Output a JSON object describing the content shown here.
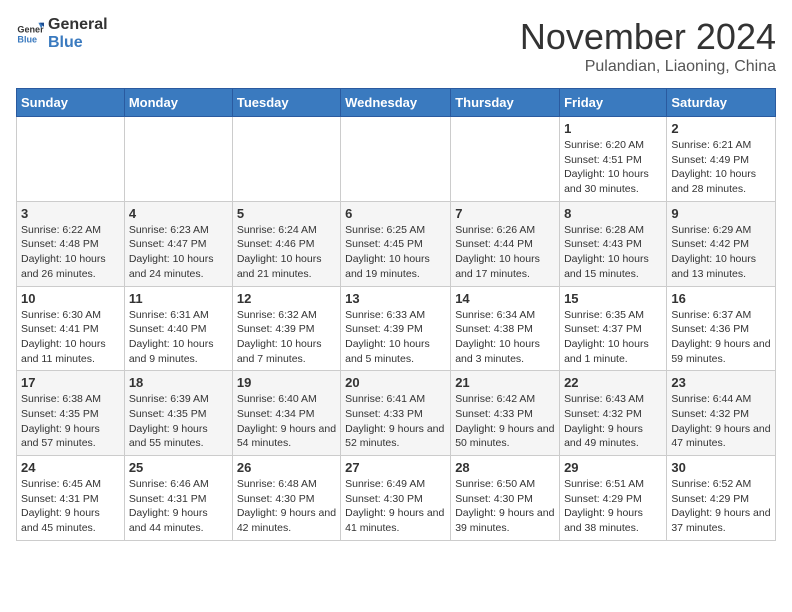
{
  "logo": {
    "general": "General",
    "blue": "Blue"
  },
  "header": {
    "month": "November 2024",
    "location": "Pulandian, Liaoning, China"
  },
  "weekdays": [
    "Sunday",
    "Monday",
    "Tuesday",
    "Wednesday",
    "Thursday",
    "Friday",
    "Saturday"
  ],
  "weeks": [
    [
      {
        "day": "",
        "info": ""
      },
      {
        "day": "",
        "info": ""
      },
      {
        "day": "",
        "info": ""
      },
      {
        "day": "",
        "info": ""
      },
      {
        "day": "",
        "info": ""
      },
      {
        "day": "1",
        "info": "Sunrise: 6:20 AM\nSunset: 4:51 PM\nDaylight: 10 hours and 30 minutes."
      },
      {
        "day": "2",
        "info": "Sunrise: 6:21 AM\nSunset: 4:49 PM\nDaylight: 10 hours and 28 minutes."
      }
    ],
    [
      {
        "day": "3",
        "info": "Sunrise: 6:22 AM\nSunset: 4:48 PM\nDaylight: 10 hours and 26 minutes."
      },
      {
        "day": "4",
        "info": "Sunrise: 6:23 AM\nSunset: 4:47 PM\nDaylight: 10 hours and 24 minutes."
      },
      {
        "day": "5",
        "info": "Sunrise: 6:24 AM\nSunset: 4:46 PM\nDaylight: 10 hours and 21 minutes."
      },
      {
        "day": "6",
        "info": "Sunrise: 6:25 AM\nSunset: 4:45 PM\nDaylight: 10 hours and 19 minutes."
      },
      {
        "day": "7",
        "info": "Sunrise: 6:26 AM\nSunset: 4:44 PM\nDaylight: 10 hours and 17 minutes."
      },
      {
        "day": "8",
        "info": "Sunrise: 6:28 AM\nSunset: 4:43 PM\nDaylight: 10 hours and 15 minutes."
      },
      {
        "day": "9",
        "info": "Sunrise: 6:29 AM\nSunset: 4:42 PM\nDaylight: 10 hours and 13 minutes."
      }
    ],
    [
      {
        "day": "10",
        "info": "Sunrise: 6:30 AM\nSunset: 4:41 PM\nDaylight: 10 hours and 11 minutes."
      },
      {
        "day": "11",
        "info": "Sunrise: 6:31 AM\nSunset: 4:40 PM\nDaylight: 10 hours and 9 minutes."
      },
      {
        "day": "12",
        "info": "Sunrise: 6:32 AM\nSunset: 4:39 PM\nDaylight: 10 hours and 7 minutes."
      },
      {
        "day": "13",
        "info": "Sunrise: 6:33 AM\nSunset: 4:39 PM\nDaylight: 10 hours and 5 minutes."
      },
      {
        "day": "14",
        "info": "Sunrise: 6:34 AM\nSunset: 4:38 PM\nDaylight: 10 hours and 3 minutes."
      },
      {
        "day": "15",
        "info": "Sunrise: 6:35 AM\nSunset: 4:37 PM\nDaylight: 10 hours and 1 minute."
      },
      {
        "day": "16",
        "info": "Sunrise: 6:37 AM\nSunset: 4:36 PM\nDaylight: 9 hours and 59 minutes."
      }
    ],
    [
      {
        "day": "17",
        "info": "Sunrise: 6:38 AM\nSunset: 4:35 PM\nDaylight: 9 hours and 57 minutes."
      },
      {
        "day": "18",
        "info": "Sunrise: 6:39 AM\nSunset: 4:35 PM\nDaylight: 9 hours and 55 minutes."
      },
      {
        "day": "19",
        "info": "Sunrise: 6:40 AM\nSunset: 4:34 PM\nDaylight: 9 hours and 54 minutes."
      },
      {
        "day": "20",
        "info": "Sunrise: 6:41 AM\nSunset: 4:33 PM\nDaylight: 9 hours and 52 minutes."
      },
      {
        "day": "21",
        "info": "Sunrise: 6:42 AM\nSunset: 4:33 PM\nDaylight: 9 hours and 50 minutes."
      },
      {
        "day": "22",
        "info": "Sunrise: 6:43 AM\nSunset: 4:32 PM\nDaylight: 9 hours and 49 minutes."
      },
      {
        "day": "23",
        "info": "Sunrise: 6:44 AM\nSunset: 4:32 PM\nDaylight: 9 hours and 47 minutes."
      }
    ],
    [
      {
        "day": "24",
        "info": "Sunrise: 6:45 AM\nSunset: 4:31 PM\nDaylight: 9 hours and 45 minutes."
      },
      {
        "day": "25",
        "info": "Sunrise: 6:46 AM\nSunset: 4:31 PM\nDaylight: 9 hours and 44 minutes."
      },
      {
        "day": "26",
        "info": "Sunrise: 6:48 AM\nSunset: 4:30 PM\nDaylight: 9 hours and 42 minutes."
      },
      {
        "day": "27",
        "info": "Sunrise: 6:49 AM\nSunset: 4:30 PM\nDaylight: 9 hours and 41 minutes."
      },
      {
        "day": "28",
        "info": "Sunrise: 6:50 AM\nSunset: 4:30 PM\nDaylight: 9 hours and 39 minutes."
      },
      {
        "day": "29",
        "info": "Sunrise: 6:51 AM\nSunset: 4:29 PM\nDaylight: 9 hours and 38 minutes."
      },
      {
        "day": "30",
        "info": "Sunrise: 6:52 AM\nSunset: 4:29 PM\nDaylight: 9 hours and 37 minutes."
      }
    ]
  ]
}
